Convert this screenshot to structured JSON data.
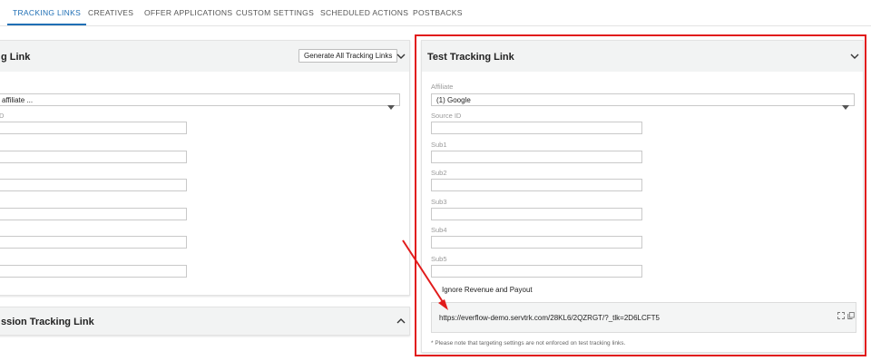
{
  "tabs": [
    {
      "label": "TRACKING LINKS",
      "active": true
    },
    {
      "label": "CREATIVES"
    },
    {
      "label": "OFFER APPLICATIONS"
    },
    {
      "label": "CUSTOM SETTINGS"
    },
    {
      "label": "SCHEDULED ACTIONS"
    },
    {
      "label": "POSTBACKS"
    }
  ],
  "left_panel": {
    "title": "g Link",
    "generate_button": "Generate All Tracking Links",
    "affiliate_value": "affiliate ...",
    "source_id_label": "D"
  },
  "left_bottom_panel": {
    "title": "ssion Tracking Link"
  },
  "test_panel": {
    "title": "Test Tracking Link",
    "affiliate_label": "Affiliate",
    "affiliate_value": "(1) Google",
    "source_id_label": "Source ID",
    "sub1_label": "Sub1",
    "sub2_label": "Sub2",
    "sub3_label": "Sub3",
    "sub4_label": "Sub4",
    "sub5_label": "Sub5",
    "ignore_label": "Ignore Revenue and Payout",
    "link_url": "https://everflow-demo.servtrk.com/28KL6/2QZRGT/?_tlk=2D6LCFT5",
    "note": "* Please note that targeting settings are not enforced on test tracking links."
  },
  "colors": {
    "accent": "#1f6fb5",
    "highlight": "#e11b1b",
    "header_bg": "#f2f3f3"
  },
  "icons": [
    "chevron-down-icon",
    "chevron-up-icon",
    "caret-down-icon",
    "expand-icon",
    "copy-icon"
  ]
}
